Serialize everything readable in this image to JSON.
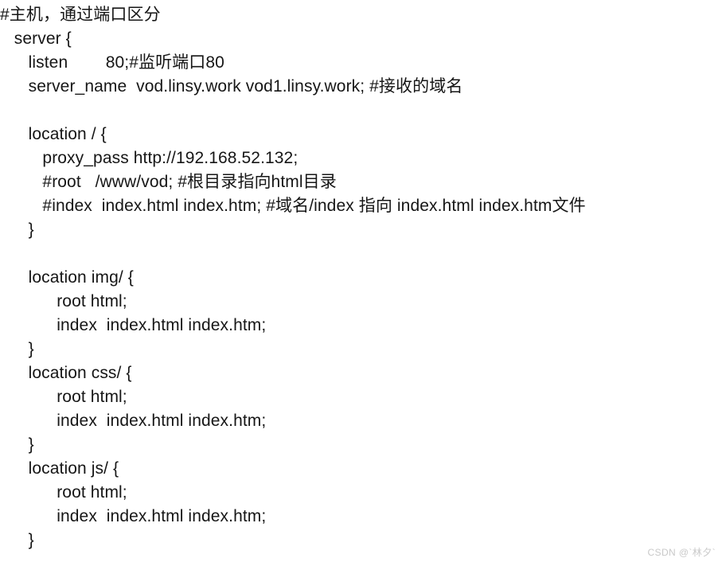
{
  "document": {
    "type": "nginx-config-snippet",
    "background_color": "#ffffff",
    "text_color": "#161616",
    "lines": [
      "#主机，通过端口区分",
      "   server {",
      "      listen        80;#监听端口80",
      "      server_name  vod.linsy.work vod1.linsy.work; #接收的域名",
      "",
      "      location / {",
      "         proxy_pass http://192.168.52.132;",
      "         #root   /www/vod; #根目录指向html目录",
      "         #index  index.html index.htm; #域名/index 指向 index.html index.htm文件",
      "      }",
      "",
      "      location img/ {",
      "            root html;",
      "            index  index.html index.htm;",
      "      }",
      "      location css/ {",
      "            root html;",
      "            index  index.html index.htm;",
      "      }",
      "      location js/ {",
      "            root html;",
      "            index  index.html index.htm;",
      "      }"
    ]
  },
  "watermark": {
    "text": "CSDN @`林夕`",
    "color": "#c9c9c9"
  }
}
